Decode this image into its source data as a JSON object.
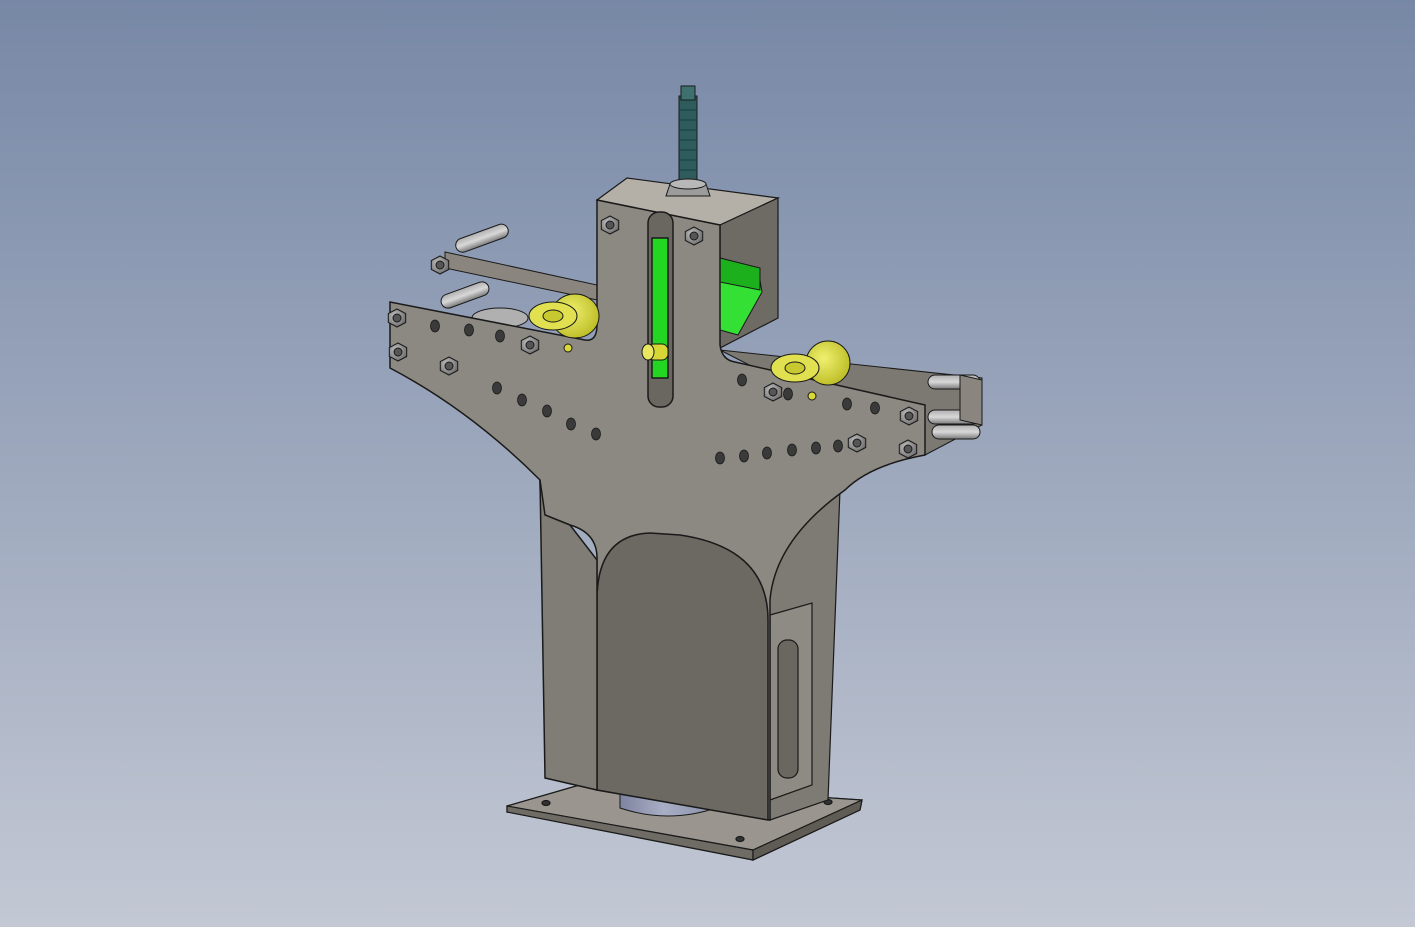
{
  "viewport": {
    "background_top": "#7788a6",
    "background_bottom": "#c3c8d4"
  },
  "model": {
    "plate_color": "#8c8882",
    "plate_shadow": "#6a6660",
    "edge_color": "#1a1a1a",
    "hole_color": "#3a3a3a",
    "nut_color": "#909090",
    "roller_color": "#d8d838",
    "die_color": "#22d622",
    "cylinder_color": "#9aa0b8",
    "screw_color": "#2e5c5c"
  }
}
